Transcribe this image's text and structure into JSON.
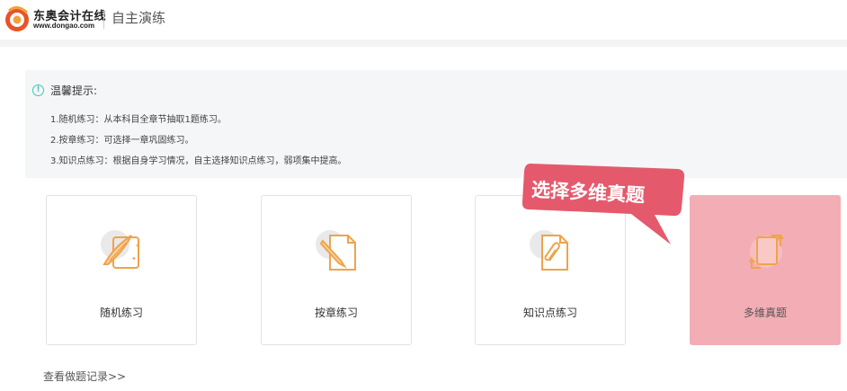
{
  "header": {
    "logo_cn": "东奥会计在线",
    "logo_en": "www.dongao.com",
    "title": "自主演练"
  },
  "tips": {
    "title": "温馨提示:",
    "lines": [
      "1.随机练习：从本科目全章节抽取1题练习。",
      "2.按章练习：可选择一章巩固练习。",
      "3.知识点练习：根据自身学习情况，自主选择知识点练习，弱项集中提高。"
    ]
  },
  "cards": [
    {
      "label": "随机练习",
      "icon": "quill-scroll-icon"
    },
    {
      "label": "按章练习",
      "icon": "pencil-document-icon"
    },
    {
      "label": "知识点练习",
      "icon": "paperclip-document-icon"
    },
    {
      "label": "多维真题",
      "icon": "rotate-document-icon"
    }
  ],
  "history_link": "查看做题记录>>",
  "callout": {
    "text": "选择多维真题"
  },
  "colors": {
    "accent_orange": "#f0a34a",
    "teal": "#3cc7b4",
    "callout_red": "#e45a6c",
    "active_card": "#f3adb5"
  }
}
